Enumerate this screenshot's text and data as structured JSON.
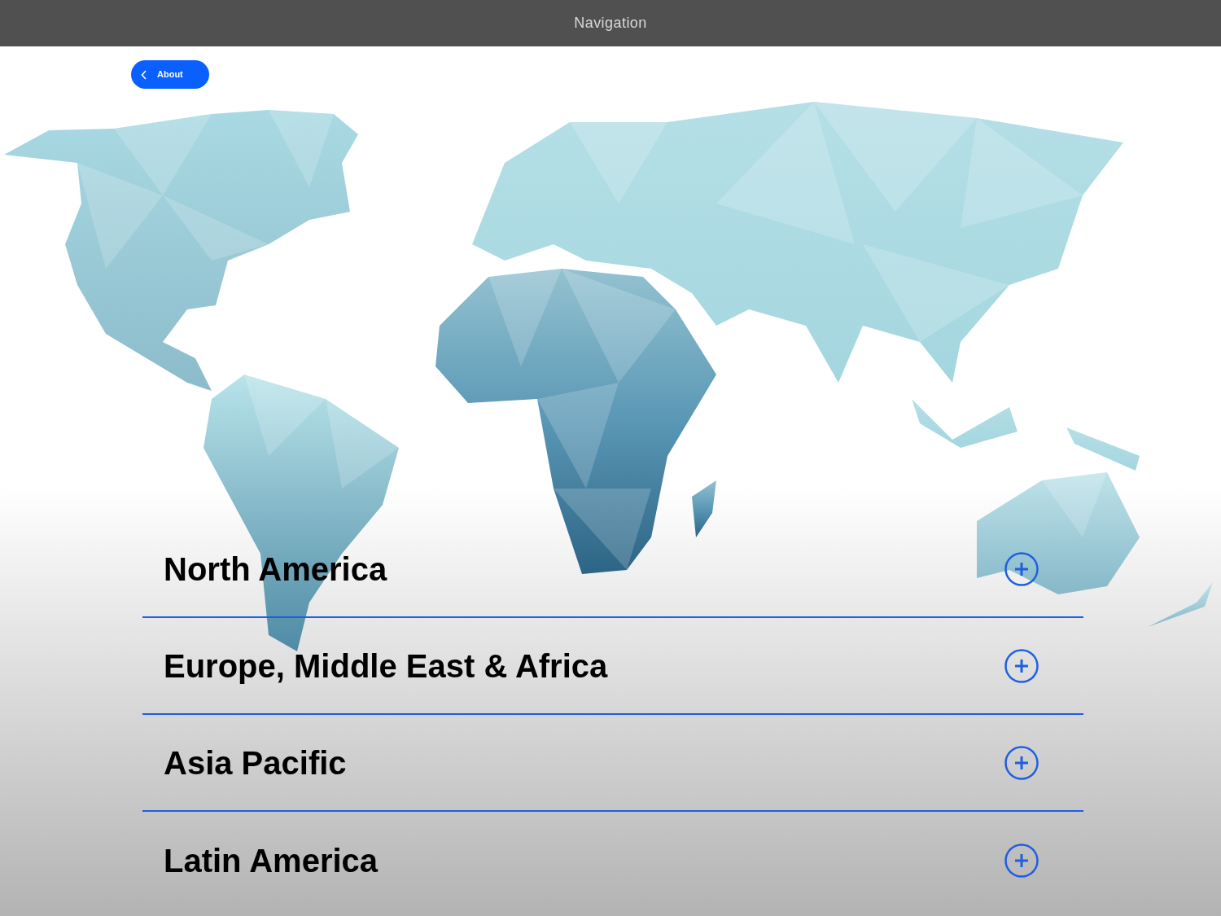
{
  "nav_bar": {
    "title": "Navigation"
  },
  "back_button": {
    "label": "About"
  },
  "regions": [
    {
      "label": "North America",
      "expanded": false
    },
    {
      "label": "Europe, Middle East & Africa",
      "expanded": false
    },
    {
      "label": "Asia Pacific",
      "expanded": false
    },
    {
      "label": "Latin America",
      "expanded": false
    }
  ]
}
